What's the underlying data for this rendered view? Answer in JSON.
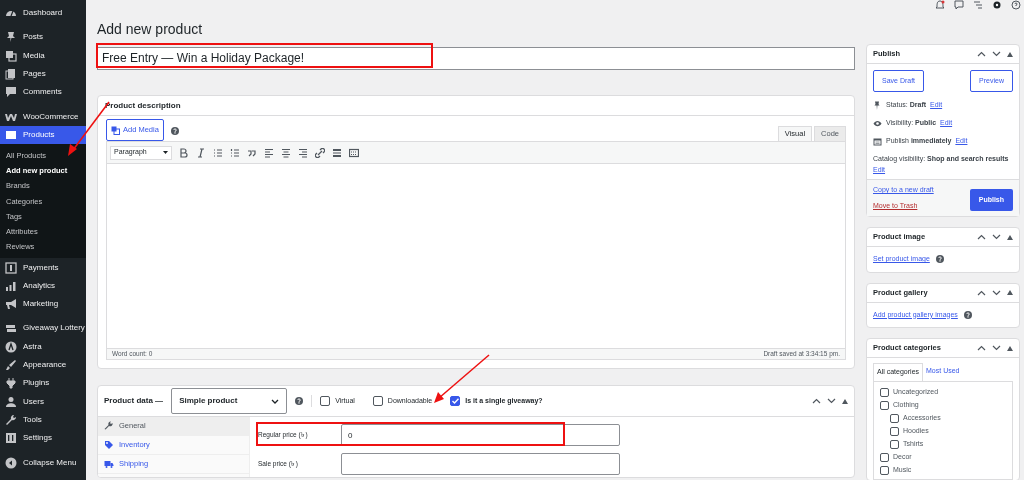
{
  "sidebar": {
    "groups": [
      [
        {
          "label": "Dashboard",
          "selected": false
        }
      ],
      [
        {
          "label": "Posts",
          "selected": false
        },
        {
          "label": "Media",
          "selected": false
        },
        {
          "label": "Pages",
          "selected": false
        },
        {
          "label": "Comments",
          "selected": false
        }
      ],
      [
        {
          "label": "WooCommerce",
          "selected": false
        },
        {
          "label": "Products",
          "selected": true,
          "children": [
            {
              "label": "All Products",
              "selected": false
            },
            {
              "label": "Add new product",
              "selected": true
            },
            {
              "label": "Brands",
              "selected": false
            },
            {
              "label": "Categories",
              "selected": false
            },
            {
              "label": "Tags",
              "selected": false
            },
            {
              "label": "Attributes",
              "selected": false
            },
            {
              "label": "Reviews",
              "selected": false
            }
          ]
        },
        {
          "label": "Payments",
          "selected": false
        },
        {
          "label": "Analytics",
          "selected": false
        },
        {
          "label": "Marketing",
          "selected": false
        }
      ],
      [
        {
          "label": "Giveaway Lottery",
          "selected": false
        },
        {
          "label": "Astra",
          "selected": false
        },
        {
          "label": "Appearance",
          "selected": false
        },
        {
          "label": "Plugins",
          "selected": false
        },
        {
          "label": "Users",
          "selected": false
        },
        {
          "label": "Tools",
          "selected": false
        },
        {
          "label": "Settings",
          "selected": false
        }
      ],
      [
        {
          "label": "Collapse Menu",
          "selected": false
        }
      ]
    ]
  },
  "page_title": "Add new product",
  "title_field": {
    "value": "Free Entry — Win a Holiday Package!"
  },
  "description": {
    "heading": "Product description",
    "add_media": "Add Media",
    "tabs": [
      {
        "label": "Visual",
        "selected": true
      },
      {
        "label": "Code",
        "selected": false
      }
    ],
    "format": "Paragraph",
    "word_count": "Word count: 0",
    "draft_saved": "Draft saved at 3:34:15 pm."
  },
  "product_data": {
    "heading": "Product data —",
    "type": "Simple product",
    "options": [
      {
        "label": "Virtual",
        "checked": false
      },
      {
        "label": "Downloadable",
        "checked": false
      },
      {
        "label": "Is it a single giveaway?",
        "checked": true
      }
    ],
    "tabs": [
      {
        "label": "General",
        "selected": true
      },
      {
        "label": "Inventory",
        "selected": false
      },
      {
        "label": "Shipping",
        "selected": false
      }
    ],
    "fields": [
      {
        "label": "Regular price (৳ )",
        "value": "0"
      },
      {
        "label": "Sale price (৳ )"
      }
    ]
  },
  "publish": {
    "heading": "Publish",
    "save_draft": "Save Draft",
    "preview": "Preview",
    "rows": [
      {
        "text": "Status: **Draft**",
        "link": "Edit"
      },
      {
        "text": "Visibility: **Public**",
        "link": "Edit"
      },
      {
        "text": "Publish **immediately**",
        "link": "Edit"
      },
      {
        "text": "Catalog visibility: **Shop and search results**",
        "link": "Edit"
      }
    ],
    "copy_link": "Copy to a new draft",
    "trash_link": "Move to Trash",
    "publish_button": "Publish"
  },
  "product_image": {
    "heading": "Product image",
    "link": "Set product image"
  },
  "product_gallery": {
    "heading": "Product gallery",
    "link": "Add product gallery images"
  },
  "categories": {
    "heading": "Product categories",
    "tabs": [
      {
        "label": "All categories",
        "selected": true
      },
      {
        "label": "Most Used",
        "selected": false
      }
    ],
    "items": [
      {
        "label": "Uncategorized",
        "checked": false
      },
      {
        "label": "Clothing",
        "checked": false,
        "children": [
          {
            "label": "Accessories",
            "checked": false
          },
          {
            "label": "Hoodies",
            "checked": false
          },
          {
            "label": "Tshirts",
            "checked": false
          }
        ]
      },
      {
        "label": "Decor",
        "checked": false
      },
      {
        "label": "Music",
        "checked": false
      }
    ]
  }
}
